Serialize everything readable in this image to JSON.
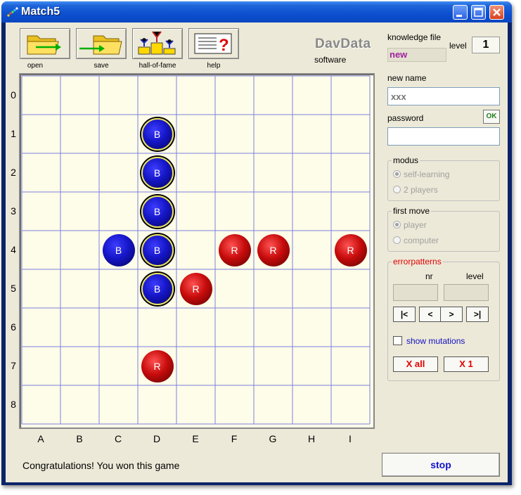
{
  "window": {
    "title": "Match5"
  },
  "toolbar": [
    {
      "id": "open",
      "label": "open",
      "icon": "folder-arrow-in-icon"
    },
    {
      "id": "save",
      "label": "save",
      "icon": "folder-arrow-out-icon"
    },
    {
      "id": "hall",
      "label": "hall-of-fame",
      "icon": "podium-icon"
    },
    {
      "id": "help",
      "label": "help",
      "icon": "help-document-icon"
    }
  ],
  "logo": {
    "brand": "DavData",
    "sub": "software"
  },
  "board": {
    "rows": [
      "0",
      "1",
      "2",
      "3",
      "4",
      "5",
      "6",
      "7",
      "8"
    ],
    "cols": [
      "A",
      "B",
      "C",
      "D",
      "E",
      "F",
      "G",
      "H",
      "I"
    ],
    "pieces": [
      {
        "col": 3,
        "row": 1,
        "player": "B",
        "winning": true
      },
      {
        "col": 3,
        "row": 2,
        "player": "B",
        "winning": true
      },
      {
        "col": 3,
        "row": 3,
        "player": "B",
        "winning": true
      },
      {
        "col": 2,
        "row": 4,
        "player": "B",
        "winning": false
      },
      {
        "col": 3,
        "row": 4,
        "player": "B",
        "winning": true
      },
      {
        "col": 5,
        "row": 4,
        "player": "R",
        "winning": false
      },
      {
        "col": 6,
        "row": 4,
        "player": "R",
        "winning": false
      },
      {
        "col": 8,
        "row": 4,
        "player": "R",
        "winning": false
      },
      {
        "col": 3,
        "row": 5,
        "player": "B",
        "winning": true
      },
      {
        "col": 4,
        "row": 5,
        "player": "R",
        "winning": false
      },
      {
        "col": 3,
        "row": 7,
        "player": "R",
        "winning": false
      }
    ],
    "colors": {
      "blue": "#1616c8",
      "red": "#c80c0c",
      "grid": "#8080e0",
      "background": "#fdfde9"
    }
  },
  "status": "Congratulations! You won this game",
  "stop_label": "stop",
  "side": {
    "knowledge_label": "knowledge file",
    "knowledge_value": "new",
    "level_label": "level",
    "level_value": "1",
    "new_name_label": "new name",
    "new_name_placeholder": "xxx",
    "password_label": "password",
    "ok_label": "OK",
    "modus": {
      "label": "modus",
      "options": [
        "self-learning",
        "2 players"
      ],
      "selected": 0
    },
    "first_move": {
      "label": "first move",
      "options": [
        "player",
        "computer"
      ],
      "selected": 0
    },
    "errorpatterns": {
      "label": "errorpatterns",
      "nr_label": "nr",
      "level_label": "level",
      "nav": [
        "|<",
        "<",
        ">",
        ">|"
      ],
      "mutations_label": "show mutations",
      "x_all": "X all",
      "x_one": "X 1"
    }
  }
}
